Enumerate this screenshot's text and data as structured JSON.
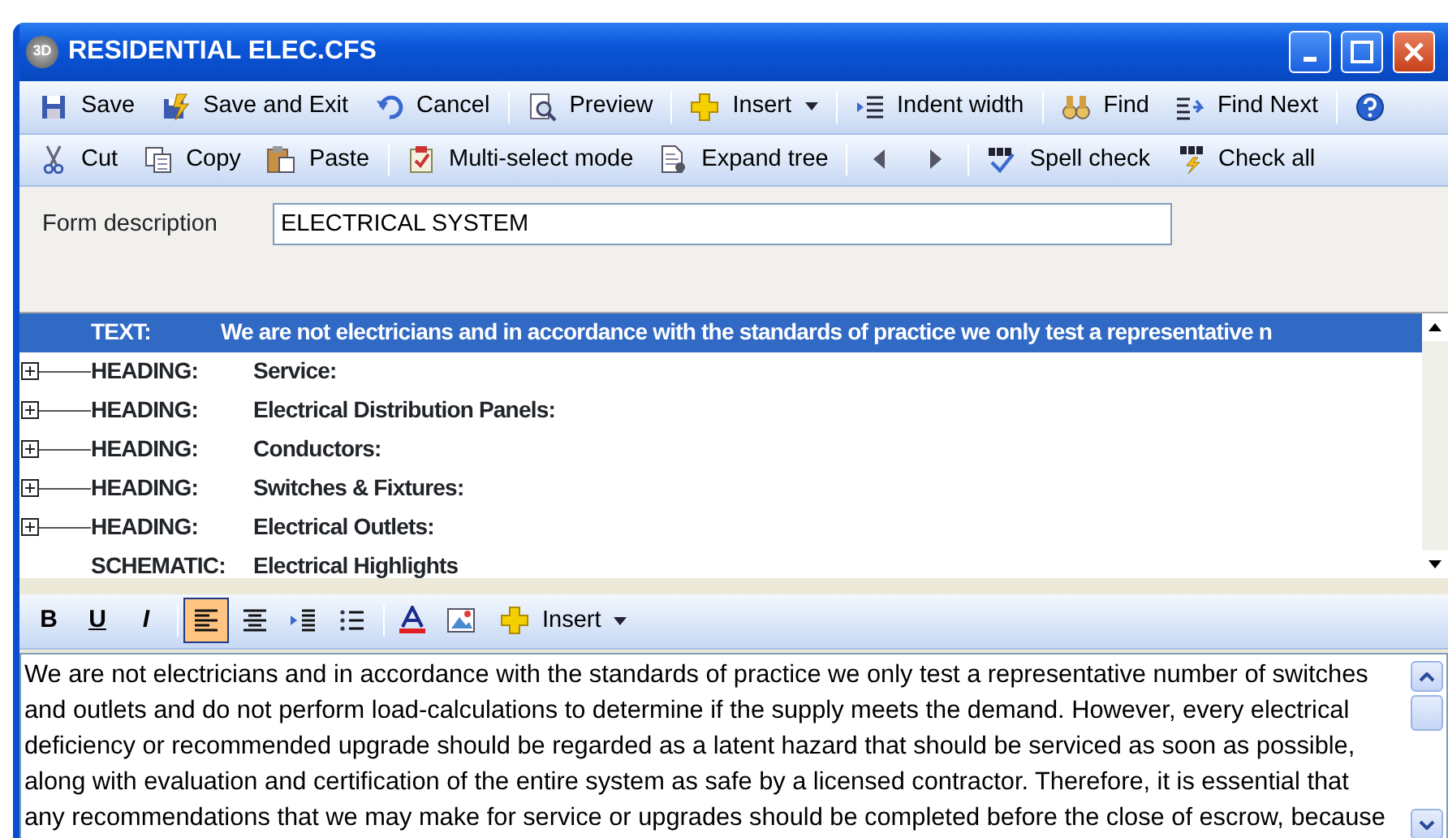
{
  "window": {
    "title": "RESIDENTIAL ELEC.CFS",
    "app_badge": "3D"
  },
  "toolbar_main": [
    {
      "kind": "button",
      "label": "Save"
    },
    {
      "kind": "button",
      "label": "Save and Exit"
    },
    {
      "kind": "button",
      "label": "Cancel"
    },
    {
      "kind": "separator"
    },
    {
      "kind": "button",
      "label": "Preview"
    },
    {
      "kind": "separator"
    },
    {
      "kind": "dropdown",
      "label": "Insert"
    },
    {
      "kind": "separator"
    },
    {
      "kind": "button",
      "label": "Indent width"
    },
    {
      "kind": "separator"
    },
    {
      "kind": "button",
      "label": "Find"
    },
    {
      "kind": "button",
      "label": "Find Next"
    },
    {
      "kind": "separator"
    },
    {
      "kind": "icon"
    }
  ],
  "toolbar_edit": [
    {
      "kind": "button",
      "label": "Cut"
    },
    {
      "kind": "button",
      "label": "Copy"
    },
    {
      "kind": "button",
      "label": "Paste"
    },
    {
      "kind": "separator"
    },
    {
      "kind": "button",
      "label": "Multi-select mode"
    },
    {
      "kind": "button",
      "label": "Expand tree"
    },
    {
      "kind": "separator"
    },
    {
      "kind": "icon"
    },
    {
      "kind": "icon"
    },
    {
      "kind": "separator"
    },
    {
      "kind": "button",
      "label": "Spell check"
    },
    {
      "kind": "button",
      "label": "Check all"
    }
  ],
  "form_description": {
    "label": "Form description",
    "value": "ELECTRICAL SYSTEM"
  },
  "tree": [
    {
      "type": "TEXT:",
      "text": "We are not electricians and in accordance with the standards of practice we only test a representative n",
      "selected": true,
      "expandable": false
    },
    {
      "type": "HEADING:",
      "text": "Service:",
      "selected": false,
      "expandable": true
    },
    {
      "type": "HEADING:",
      "text": "Electrical Distribution Panels:",
      "selected": false,
      "expandable": true
    },
    {
      "type": "HEADING:",
      "text": "Conductors:",
      "selected": false,
      "expandable": true
    },
    {
      "type": "HEADING:",
      "text": "Switches & Fixtures:",
      "selected": false,
      "expandable": true
    },
    {
      "type": "HEADING:",
      "text": "Electrical Outlets:",
      "selected": false,
      "expandable": true
    },
    {
      "type": "SCHEMATIC:",
      "text": "Electrical Highlights",
      "selected": false,
      "expandable": false
    }
  ],
  "format_toolbar": [
    {
      "kind": "letter",
      "label": "B",
      "selected": false
    },
    {
      "kind": "letter",
      "label": "U",
      "selected": false
    },
    {
      "kind": "letter",
      "label": "I",
      "selected": false
    },
    {
      "kind": "separator"
    },
    {
      "kind": "icon",
      "selected": true
    },
    {
      "kind": "icon",
      "selected": false
    },
    {
      "kind": "icon",
      "selected": false
    },
    {
      "kind": "icon",
      "selected": false
    },
    {
      "kind": "separator"
    },
    {
      "kind": "icon",
      "selected": false
    },
    {
      "kind": "icon",
      "selected": false
    },
    {
      "kind": "dropdown",
      "label": "Insert"
    }
  ],
  "editor": {
    "lines": [
      "We are not electricians and in accordance with the standards of practice we only test a representative number of switches",
      "and outlets and do not perform load-calculations to determine if the supply meets the demand.  However, every electrical",
      "deficiency or recommended upgrade should be regarded as a latent hazard that should be serviced as soon as possible,",
      "along with evaluation and certification of the entire system as safe by a licensed contractor.  Therefore, it is essential that",
      "any recommendations that we may make for service or upgrades should be completed before the close of escrow, because"
    ]
  }
}
